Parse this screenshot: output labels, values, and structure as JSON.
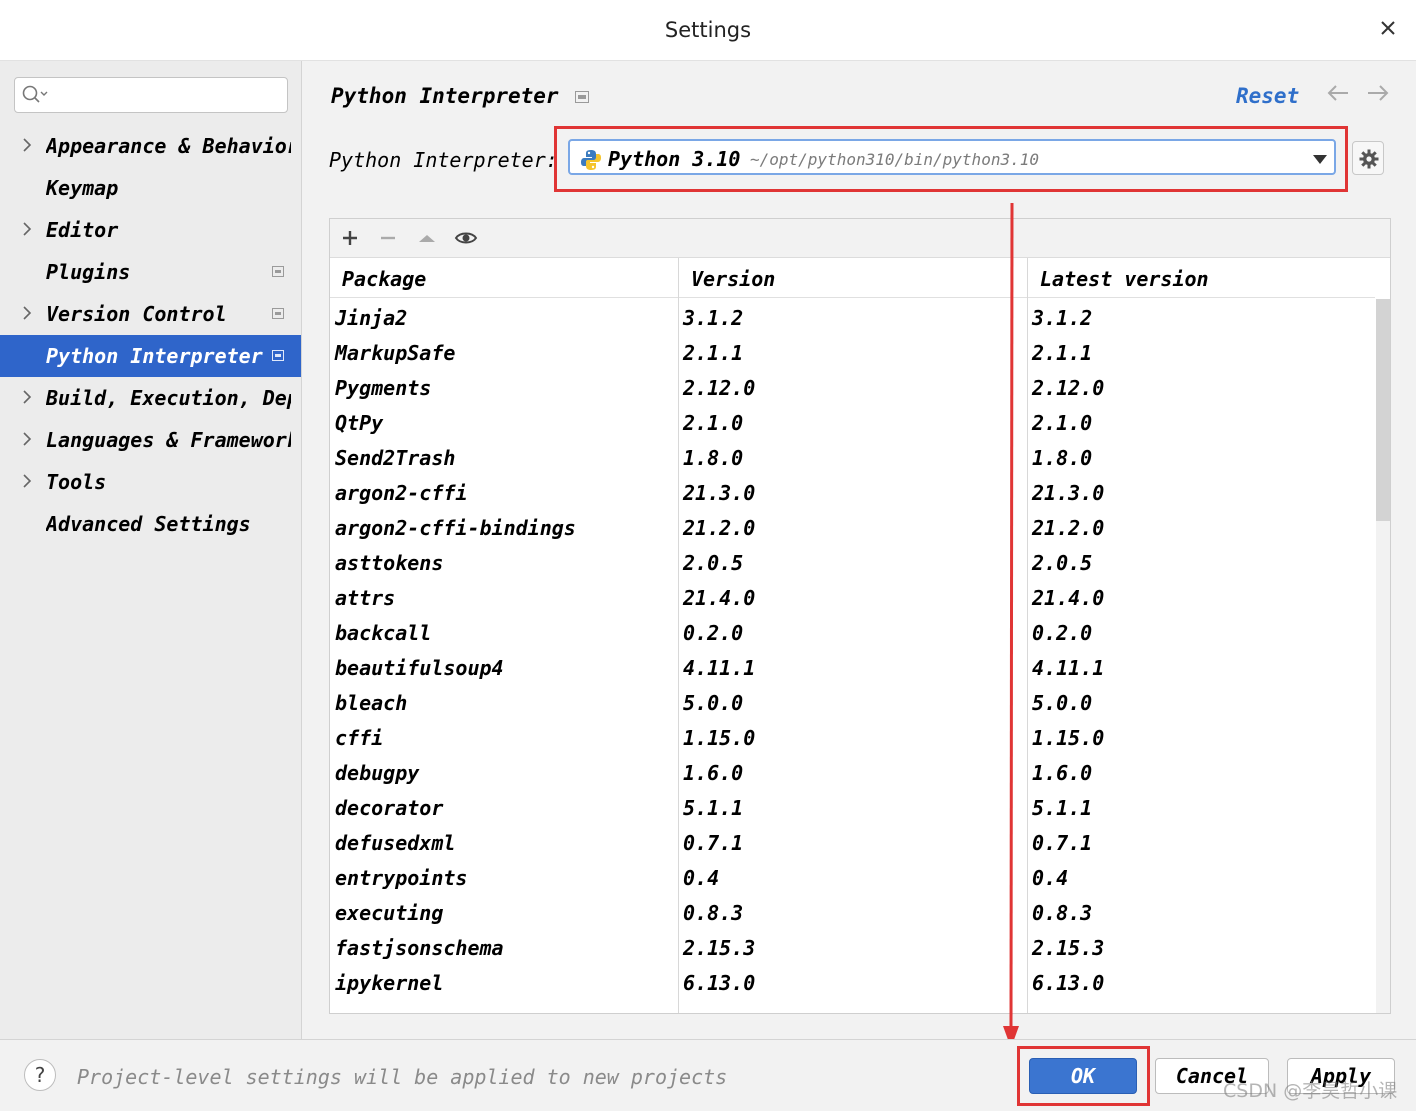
{
  "window": {
    "title": "Settings"
  },
  "sidebar": {
    "search_placeholder": "",
    "items": [
      {
        "label": "Appearance & Behavior",
        "expandable": true,
        "project_scope": false,
        "selected": false
      },
      {
        "label": "Keymap",
        "expandable": false,
        "project_scope": false,
        "selected": false
      },
      {
        "label": "Editor",
        "expandable": true,
        "project_scope": false,
        "selected": false
      },
      {
        "label": "Plugins",
        "expandable": false,
        "project_scope": true,
        "selected": false
      },
      {
        "label": "Version Control",
        "expandable": true,
        "project_scope": true,
        "selected": false
      },
      {
        "label": "Python Interpreter",
        "expandable": false,
        "project_scope": true,
        "selected": true
      },
      {
        "label": "Build, Execution, Deployment",
        "expandable": true,
        "project_scope": false,
        "selected": false
      },
      {
        "label": "Languages & Frameworks",
        "expandable": true,
        "project_scope": false,
        "selected": false
      },
      {
        "label": "Tools",
        "expandable": true,
        "project_scope": false,
        "selected": false
      },
      {
        "label": "Advanced Settings",
        "expandable": false,
        "project_scope": false,
        "selected": false
      }
    ]
  },
  "main": {
    "title": "Python Interpreter",
    "reset_label": "Reset",
    "interpreter_label": "Python Interpreter:",
    "interpreter": {
      "name": "Python 3.10",
      "path": "~/opt/python310/bin/python3.10"
    },
    "toolbar": [
      "plus-icon",
      "minus-icon",
      "up-icon",
      "eye-icon"
    ],
    "columns": [
      "Package",
      "Version",
      "Latest version"
    ],
    "packages": [
      [
        "Jinja2",
        "3.1.2",
        "3.1.2"
      ],
      [
        "MarkupSafe",
        "2.1.1",
        "2.1.1"
      ],
      [
        "Pygments",
        "2.12.0",
        "2.12.0"
      ],
      [
        "QtPy",
        "2.1.0",
        "2.1.0"
      ],
      [
        "Send2Trash",
        "1.8.0",
        "1.8.0"
      ],
      [
        "argon2-cffi",
        "21.3.0",
        "21.3.0"
      ],
      [
        "argon2-cffi-bindings",
        "21.2.0",
        "21.2.0"
      ],
      [
        "asttokens",
        "2.0.5",
        "2.0.5"
      ],
      [
        "attrs",
        "21.4.0",
        "21.4.0"
      ],
      [
        "backcall",
        "0.2.0",
        "0.2.0"
      ],
      [
        "beautifulsoup4",
        "4.11.1",
        "4.11.1"
      ],
      [
        "bleach",
        "5.0.0",
        "5.0.0"
      ],
      [
        "cffi",
        "1.15.0",
        "1.15.0"
      ],
      [
        "debugpy",
        "1.6.0",
        "1.6.0"
      ],
      [
        "decorator",
        "5.1.1",
        "5.1.1"
      ],
      [
        "defusedxml",
        "0.7.1",
        "0.7.1"
      ],
      [
        "entrypoints",
        "0.4",
        "0.4"
      ],
      [
        "executing",
        "0.8.3",
        "0.8.3"
      ],
      [
        "fastjsonschema",
        "2.15.3",
        "2.15.3"
      ],
      [
        "ipykernel",
        "6.13.0",
        "6.13.0"
      ]
    ]
  },
  "footer": {
    "hint": "Project-level settings will be applied to new projects",
    "ok_label": "OK",
    "cancel_label": "Cancel",
    "apply_label": "Apply",
    "watermark": "CSDN @李昊哲小课"
  },
  "colors": {
    "selection": "#2f65ca",
    "link": "#2f6fca",
    "primary_button": "#3b75d0",
    "annotation_red": "#e03535"
  }
}
